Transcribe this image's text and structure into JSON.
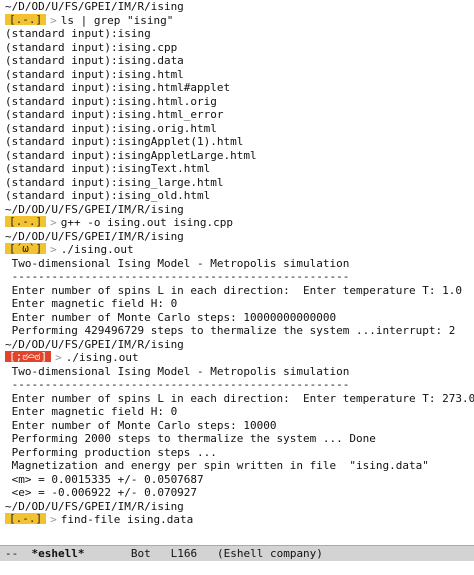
{
  "terminal": {
    "lines": [
      {
        "type": "text",
        "text": "~/D/OD/U/FS/GPEI/IM/R/ising"
      },
      {
        "type": "prompt",
        "badge": "[.-.]",
        "status": "ok",
        "arrow": ">",
        "text": "ls | grep \"ising\""
      },
      {
        "type": "text",
        "text": "(standard input):ising"
      },
      {
        "type": "text",
        "text": "(standard input):ising.cpp"
      },
      {
        "type": "text",
        "text": "(standard input):ising.data"
      },
      {
        "type": "text",
        "text": "(standard input):ising.html"
      },
      {
        "type": "text",
        "text": "(standard input):ising.html#applet"
      },
      {
        "type": "text",
        "text": "(standard input):ising.html.orig"
      },
      {
        "type": "text",
        "text": "(standard input):ising.html_error"
      },
      {
        "type": "text",
        "text": "(standard input):ising.orig.html"
      },
      {
        "type": "text",
        "text": "(standard input):isingApplet(1).html"
      },
      {
        "type": "text",
        "text": "(standard input):isingAppletLarge.html"
      },
      {
        "type": "text",
        "text": "(standard input):isingText.html"
      },
      {
        "type": "text",
        "text": "(standard input):ising_large.html"
      },
      {
        "type": "text",
        "text": "(standard input):ising_old.html"
      },
      {
        "type": "text",
        "text": "~/D/OD/U/FS/GPEI/IM/R/ising"
      },
      {
        "type": "prompt",
        "badge": "[.-.]",
        "status": "ok",
        "arrow": ">",
        "text": "g++ -o ising.out ising.cpp"
      },
      {
        "type": "text",
        "text": "~/D/OD/U/FS/GPEI/IM/R/ising"
      },
      {
        "type": "prompt",
        "badge": "[´ω`]",
        "status": "ok",
        "arrow": ">",
        "text": "./ising.out"
      },
      {
        "type": "text",
        "text": " Two-dimensional Ising Model - Metropolis simulation"
      },
      {
        "type": "text",
        "text": " ---------------------------------------------------"
      },
      {
        "type": "text",
        "text": " Enter number of spins L in each direction:  Enter temperature T: 1.0"
      },
      {
        "type": "text",
        "text": " Enter magnetic field H: 0"
      },
      {
        "type": "text",
        "text": " Enter number of Monte Carlo steps: 10000000000000"
      },
      {
        "type": "text",
        "text": " Performing 429496729 steps to thermalize the system ...interrupt: 2"
      },
      {
        "type": "text",
        "text": "~/D/OD/U/FS/GPEI/IM/R/ising"
      },
      {
        "type": "prompt",
        "badge": "[;ಠ⌓ಠ]",
        "status": "err",
        "arrow": ">",
        "text": "./ising.out"
      },
      {
        "type": "text",
        "text": " Two-dimensional Ising Model - Metropolis simulation"
      },
      {
        "type": "text",
        "text": " ---------------------------------------------------"
      },
      {
        "type": "text",
        "text": " Enter number of spins L in each direction:  Enter temperature T: 273.0"
      },
      {
        "type": "text",
        "text": " Enter magnetic field H: 0"
      },
      {
        "type": "text",
        "text": " Enter number of Monte Carlo steps: 10000"
      },
      {
        "type": "text",
        "text": " Performing 2000 steps to thermalize the system ... Done"
      },
      {
        "type": "text",
        "text": " Performing production steps ..."
      },
      {
        "type": "text",
        "text": " Magnetization and energy per spin written in file  \"ising.data\""
      },
      {
        "type": "text",
        "text": " <m> = 0.0015335 +/- 0.0507687"
      },
      {
        "type": "text",
        "text": " <e> = -0.006922 +/- 0.070927"
      },
      {
        "type": "text",
        "text": "~/D/OD/U/FS/GPEI/IM/R/ising"
      },
      {
        "type": "prompt",
        "badge": "[.-.]",
        "status": "ok",
        "arrow": ">",
        "text": "find-file ising.data"
      }
    ]
  },
  "modeline": {
    "dashes": "--",
    "buffer": "*eshell*",
    "position": "Bot",
    "line": "L166",
    "mode": "(Eshell company)"
  },
  "colors": {
    "badge_ok": "#f2c230",
    "badge_err": "#e0452b",
    "modeline_bg": "#d3d3d3"
  }
}
